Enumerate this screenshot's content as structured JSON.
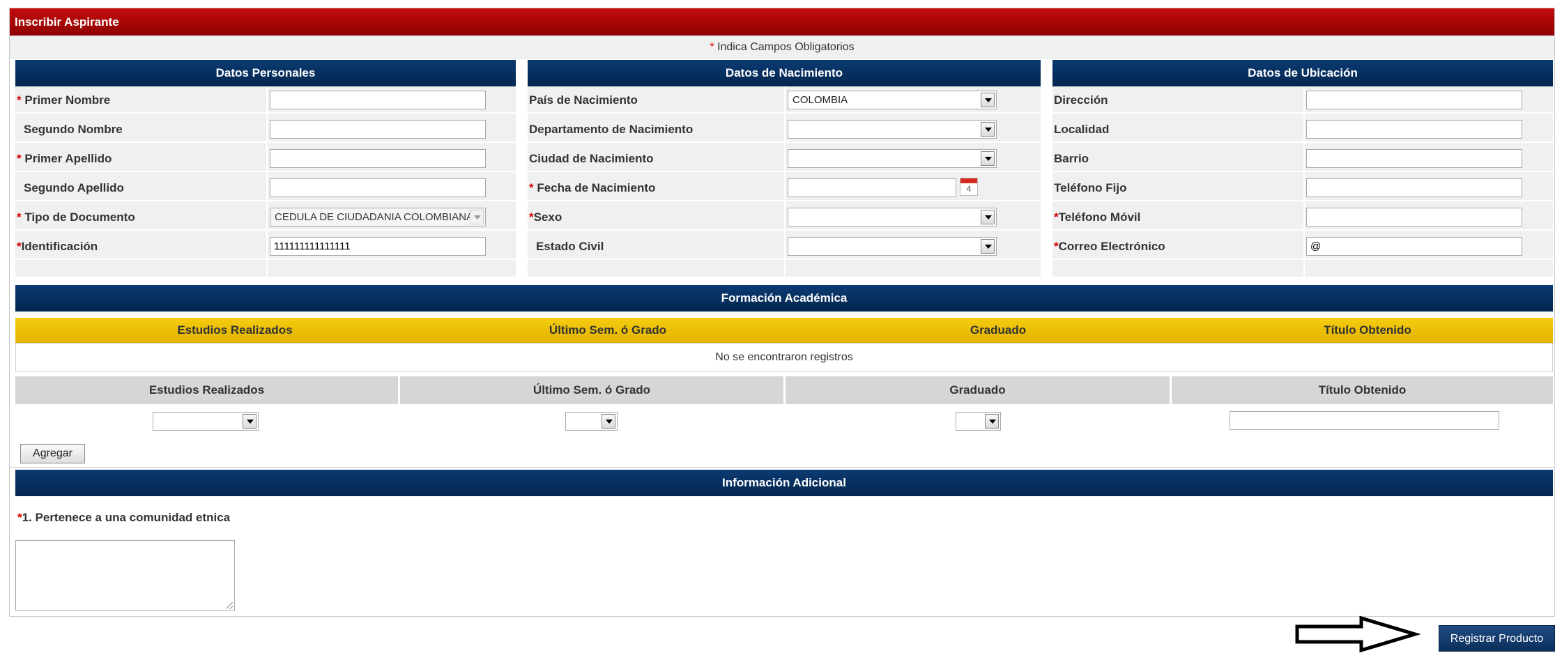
{
  "title": "Inscribir Aspirante",
  "required_note": "Indica Campos Obligatorios",
  "required_mark": "*",
  "personal": {
    "header": "Datos Personales",
    "fields": [
      {
        "label": "Primer Nombre",
        "required": true,
        "value": ""
      },
      {
        "label": "Segundo Nombre",
        "required": false,
        "value": ""
      },
      {
        "label": "Primer Apellido",
        "required": true,
        "value": ""
      },
      {
        "label": "Segundo Apellido",
        "required": false,
        "value": ""
      },
      {
        "label": "Tipo de Documento",
        "required": true,
        "value": "CEDULA DE CIUDADANIA COLOMBIANA"
      },
      {
        "label": "Identificación",
        "required": true,
        "value": "111111111111111"
      }
    ]
  },
  "birth": {
    "header": "Datos de Nacimiento",
    "fields": [
      {
        "label": "País de Nacimiento",
        "required": false,
        "value": "COLOMBIA"
      },
      {
        "label": "Departamento de Nacimiento",
        "required": false,
        "value": ""
      },
      {
        "label": "Ciudad de Nacimiento",
        "required": false,
        "value": ""
      },
      {
        "label": "Fecha de Nacimiento",
        "required": true,
        "value": ""
      },
      {
        "label": "Sexo",
        "required": true,
        "value": ""
      },
      {
        "label": "Estado Civil",
        "required": false,
        "value": ""
      }
    ],
    "calendar_day": "4"
  },
  "location": {
    "header": "Datos de Ubicación",
    "fields": [
      {
        "label": "Dirección",
        "required": false,
        "value": ""
      },
      {
        "label": "Localidad",
        "required": false,
        "value": ""
      },
      {
        "label": "Barrio",
        "required": false,
        "value": ""
      },
      {
        "label": "Teléfono Fijo",
        "required": false,
        "value": ""
      },
      {
        "label": "Teléfono Móvil",
        "required": true,
        "value": ""
      },
      {
        "label": "Correo Electrónico",
        "required": true,
        "value": "@"
      }
    ]
  },
  "academic": {
    "header": "Formación Académica",
    "columns": [
      "Estudios Realizados",
      "Último Sem. ó Grado",
      "Graduado",
      "Título Obtenido"
    ],
    "empty_message": "No se encontraron registros",
    "add_button": "Agregar"
  },
  "additional": {
    "header": "Información Adicional",
    "question": "1. Pertenece a una comunidad etnica",
    "answer": ""
  },
  "submit_label": "Registrar Producto"
}
